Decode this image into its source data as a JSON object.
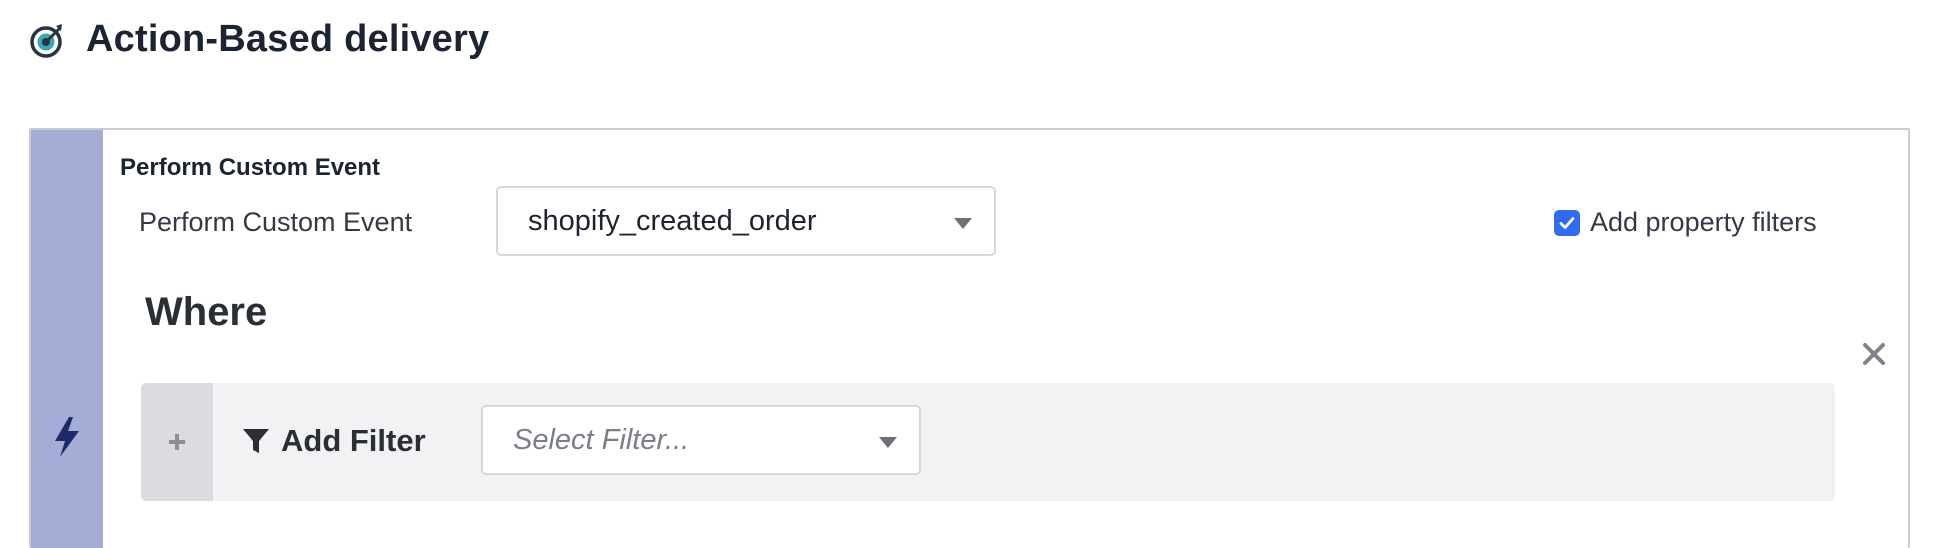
{
  "header": {
    "title": "Action-Based delivery",
    "icon": "target-icon"
  },
  "trigger": {
    "section_label": "Perform Custom Event",
    "event_label": "Perform Custom Event",
    "event_selected": "shopify_created_order",
    "property_filters_label": "Add property filters",
    "property_filters_checked": true,
    "trigger_icon": "bolt-icon",
    "accent_color": "#a5acd6"
  },
  "filters": {
    "where_label": "Where",
    "add_filter_label": "Add Filter",
    "select_placeholder": "Select Filter..."
  },
  "colors": {
    "checkbox": "#2f6cf0",
    "bolt": "#1f2a6b"
  }
}
